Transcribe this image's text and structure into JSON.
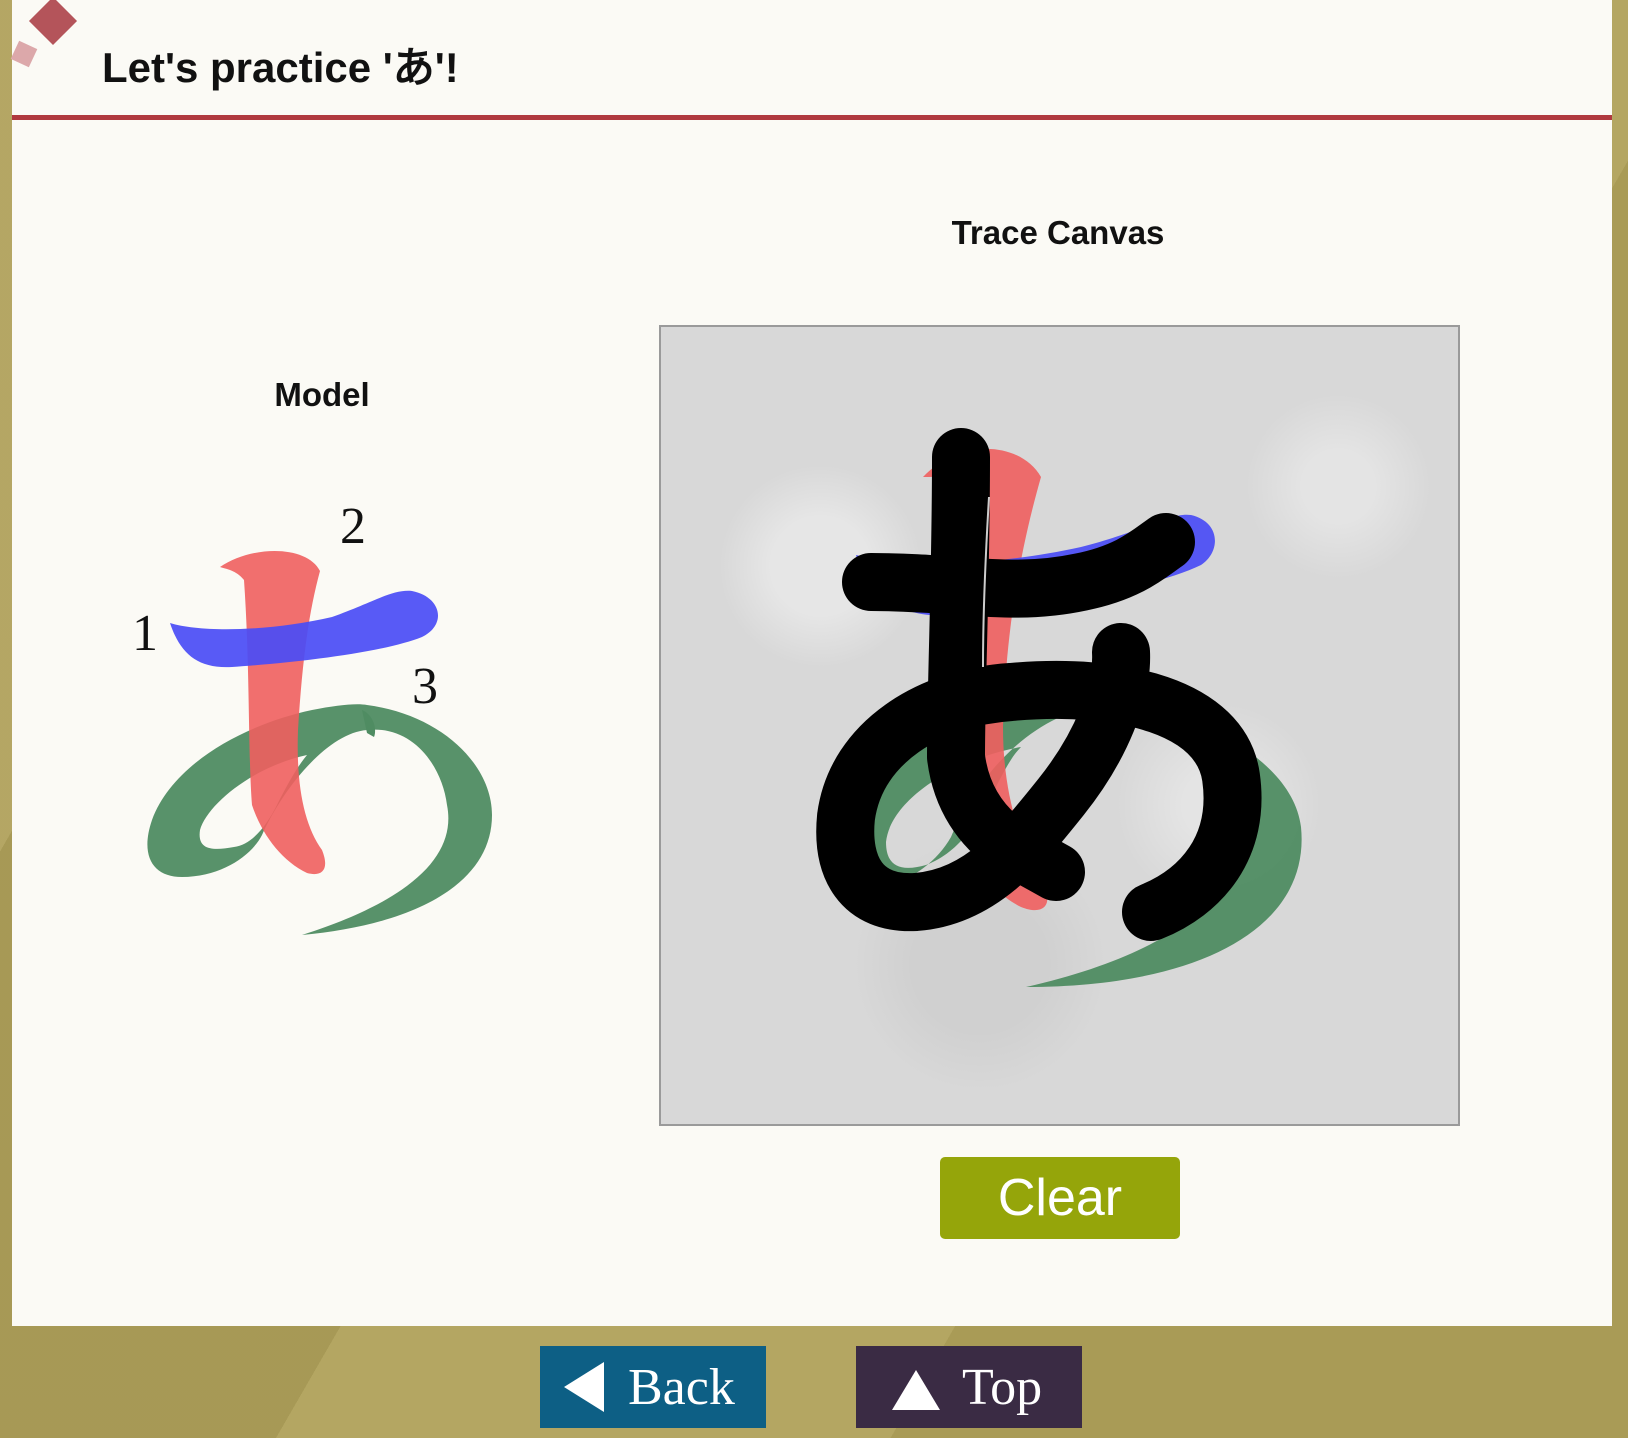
{
  "header": {
    "title": "Let's practice 'あ'!"
  },
  "model": {
    "label": "Model",
    "stroke_numbers": [
      "1",
      "2",
      "3"
    ],
    "stroke_colors": {
      "stroke1": "#4a4cf5",
      "stroke2": "#ef5f5f",
      "stroke3": "#4f8c62"
    }
  },
  "trace": {
    "label": "Trace Canvas"
  },
  "actions": {
    "clear_label": "Clear"
  },
  "nav": {
    "back_label": "Back",
    "top_label": "Top"
  },
  "colors": {
    "title_rule": "#b0393f",
    "clear_button": "#95a50a",
    "back_button": "#0d5f85",
    "top_button": "#3a2b44"
  }
}
